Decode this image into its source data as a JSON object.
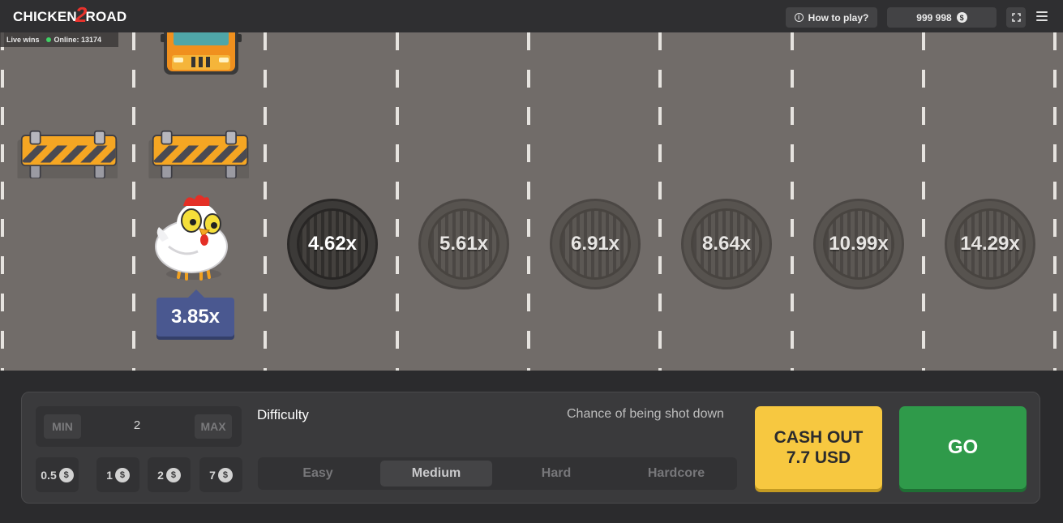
{
  "header": {
    "logo_part1": "CHICKEN",
    "logo_two": "2",
    "logo_part2": "ROAD",
    "how_to_play": "How to play?",
    "balance": "999 998",
    "currency_symbol": "$"
  },
  "live": {
    "live_wins": "Live wins",
    "online": "Online: 13174"
  },
  "game": {
    "current_multiplier": "3.85x",
    "multipliers": [
      "4.62x",
      "5.61x",
      "6.91x",
      "8.64x",
      "10.99x",
      "14.29x"
    ]
  },
  "controls": {
    "min_label": "MIN",
    "max_label": "MAX",
    "bet_value": "2",
    "quick_bets": [
      "0.5",
      "1",
      "2",
      "7"
    ],
    "difficulty_label": "Difficulty",
    "chance_label": "Chance of being shot down",
    "difficulties": [
      "Easy",
      "Medium",
      "Hard",
      "Hardcore"
    ],
    "selected_difficulty": "Medium",
    "cashout_line1": "CASH OUT",
    "cashout_line2": "7.7 USD",
    "go_label": "GO"
  },
  "colors": {
    "road": "#716c69",
    "cashout": "#f7c840",
    "go": "#2f9a4a",
    "tag": "#4a5890"
  }
}
